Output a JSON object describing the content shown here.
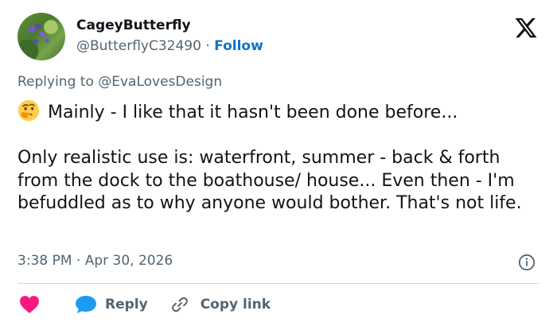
{
  "author": {
    "display_name": "CageyButterfly",
    "handle": "@ButterflyC32490",
    "separator": "·",
    "follow_label": "Follow"
  },
  "reply_context": {
    "prefix": "Replying to",
    "mention": "@EvaLovesDesign"
  },
  "tweet": {
    "emoji": "thinking-face",
    "text": "Mainly - I like that it hasn't been done before...\n\nOnly realistic use is: waterfront, summer - back & forth from the dock to the boathouse/ house... Even then - I'm befuddled as to why anyone would bother. That's not life."
  },
  "meta": {
    "time": "3:38 PM",
    "separator": "·",
    "date": "Apr 30, 2026"
  },
  "actions": {
    "reply_label": "Reply",
    "copy_link_label": "Copy link"
  },
  "colors": {
    "text": "#0f1419",
    "secondary": "#536471",
    "link": "#0f73c7",
    "heart": "#f91880",
    "reply_bubble": "#1d9bf0",
    "divider": "#cfd9de"
  },
  "icons": [
    "x-logo-icon",
    "info-icon",
    "heart-icon",
    "reply-bubble-icon",
    "link-icon"
  ]
}
